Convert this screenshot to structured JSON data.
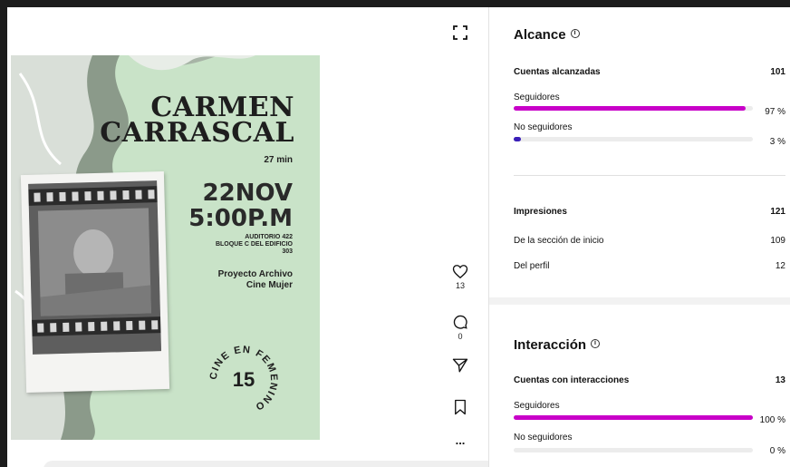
{
  "poster": {
    "title_line1": "CARMEN",
    "title_line2": "CARRASCAL",
    "duration": "27 min",
    "date": "22NOV",
    "time": "5:00P.M",
    "venue_line1": "AUDITORIO 422",
    "venue_line2": "BLOQUE C DEL EDIFICIO",
    "venue_line3": "303",
    "project_line1": "Proyecto Archivo",
    "project_line2": "Cine Mujer",
    "stamp_text": "CINE EN FEMENINO",
    "stamp_number": "15"
  },
  "actions": {
    "likes": "13",
    "comments": "0",
    "more": "..."
  },
  "reach": {
    "title": "Alcance",
    "accounts_label": "Cuentas alcanzadas",
    "accounts_value": "101",
    "followers_label": "Seguidores",
    "followers_pct": "97 %",
    "followers_fraction": 0.97,
    "non_followers_label": "No seguidores",
    "non_followers_pct": "3 %",
    "non_followers_fraction": 0.03
  },
  "impressions": {
    "title_label": "Impresiones",
    "total": "121",
    "home_label": "De la sección de inicio",
    "home_value": "109",
    "profile_label": "Del perfil",
    "profile_value": "12"
  },
  "interaction": {
    "title": "Interacción",
    "accounts_label": "Cuentas con interacciones",
    "accounts_value": "13",
    "followers_label": "Seguidores",
    "followers_pct": "100 %",
    "followers_fraction": 1.0,
    "non_followers_label": "No seguidores",
    "non_followers_pct": "0 %",
    "non_followers_fraction": 0.0
  },
  "colors": {
    "followers_bar": "#c800c8",
    "non_followers_bar": "#3a1fb8",
    "poster_bg": "#c9e3c8"
  }
}
